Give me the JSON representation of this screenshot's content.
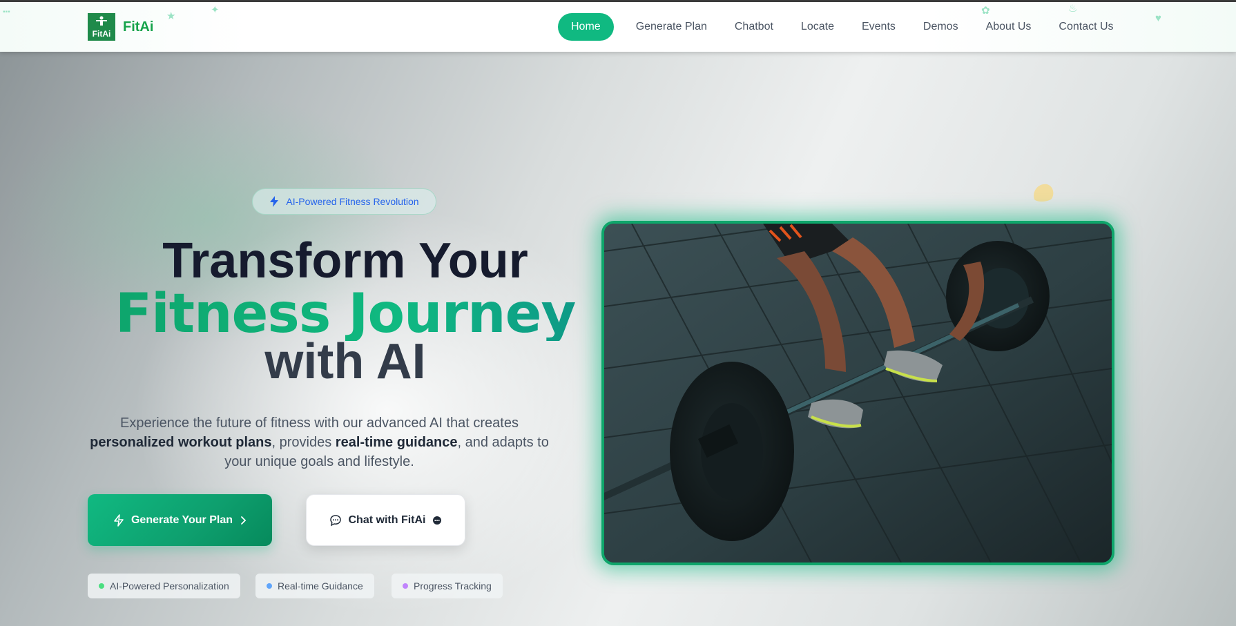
{
  "brand": {
    "logo_text": "FitAi",
    "logo_box_text": "FitAi",
    "accent_color": "#10b981"
  },
  "nav": {
    "items": [
      {
        "label": "Home",
        "active": true
      },
      {
        "label": "Generate Plan"
      },
      {
        "label": "Chatbot"
      },
      {
        "label": "Locate"
      },
      {
        "label": "Events"
      },
      {
        "label": "Demos"
      },
      {
        "label": "About Us"
      },
      {
        "label": "Contact Us"
      }
    ]
  },
  "hero": {
    "badge": "AI-Powered Fitness Revolution",
    "title_line1": "Transform Your",
    "title_line2": "Fitness Journey",
    "title_line3": "with AI",
    "desc_part1": "Experience the future of fitness with our advanced AI that creates ",
    "desc_bold1": "personalized workout plans",
    "desc_part2": ", provides ",
    "desc_bold2": "real-time guidance",
    "desc_part3": ", and adapts to your unique goals and lifestyle.",
    "primary_button": "Generate Your Plan",
    "secondary_button": "Chat with FitAi",
    "features": [
      {
        "label": "AI-Powered Personalization",
        "color": "#4ade80"
      },
      {
        "label": "Real-time Guidance",
        "color": "#60a5fa"
      },
      {
        "label": "Progress Tracking",
        "color": "#c084fc"
      }
    ]
  }
}
